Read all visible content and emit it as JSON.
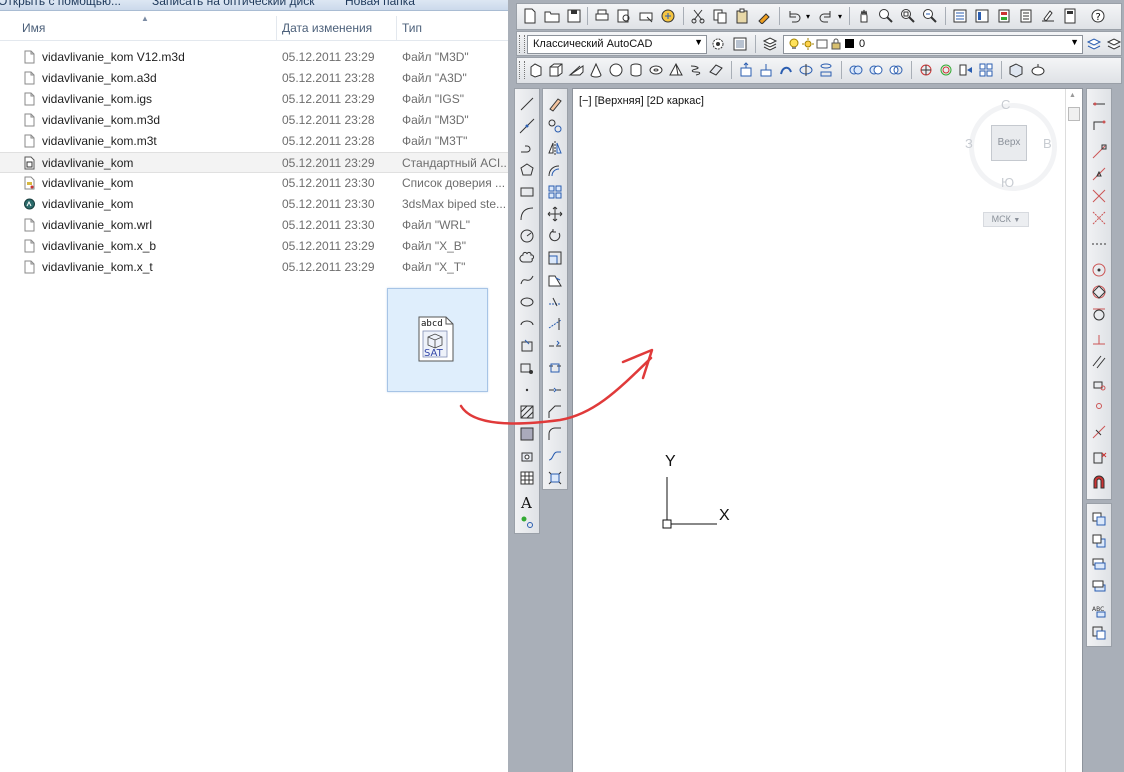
{
  "explorer": {
    "toolbar": {
      "open_with": "Открыть с помощью...",
      "burn": "Записать на оптический диск",
      "new_folder": "Новая папка"
    },
    "columns": {
      "name": "Имя",
      "date": "Дата изменения",
      "type": "Тип"
    },
    "files": [
      {
        "name": "vidavlivanie_kom V12.m3d",
        "date": "05.12.2011 23:29",
        "type": "Файл \"M3D\"",
        "icon": "document-icon"
      },
      {
        "name": "vidavlivanie_kom.a3d",
        "date": "05.12.2011 23:28",
        "type": "Файл \"A3D\"",
        "icon": "document-icon"
      },
      {
        "name": "vidavlivanie_kom.igs",
        "date": "05.12.2011 23:29",
        "type": "Файл \"IGS\"",
        "icon": "document-icon"
      },
      {
        "name": "vidavlivanie_kom.m3d",
        "date": "05.12.2011 23:28",
        "type": "Файл \"M3D\"",
        "icon": "document-icon"
      },
      {
        "name": "vidavlivanie_kom.m3t",
        "date": "05.12.2011 23:28",
        "type": "Файл \"M3T\"",
        "icon": "document-icon"
      },
      {
        "name": "vidavlivanie_kom",
        "date": "05.12.2011 23:29",
        "type": "Стандартный ACI...",
        "icon": "acis-file-icon",
        "selected": true
      },
      {
        "name": "vidavlivanie_kom",
        "date": "05.12.2011 23:30",
        "type": "Список доверия ...",
        "icon": "certificate-file-icon"
      },
      {
        "name": "vidavlivanie_kom",
        "date": "05.12.2011 23:30",
        "type": "3dsMax biped ste...",
        "icon": "3dsmax-file-icon"
      },
      {
        "name": "vidavlivanie_kom.wrl",
        "date": "05.12.2011 23:30",
        "type": "Файл \"WRL\"",
        "icon": "document-icon"
      },
      {
        "name": "vidavlivanie_kom.x_b",
        "date": "05.12.2011 23:29",
        "type": "Файл \"X_B\"",
        "icon": "document-icon"
      },
      {
        "name": "vidavlivanie_kom.x_t",
        "date": "05.12.2011 23:29",
        "type": "Файл \"X_T\"",
        "icon": "document-icon"
      }
    ],
    "drag_ghost": {
      "icon": "sat-file-icon",
      "icon_text_top": "abcd",
      "icon_text_bottom": "SAT"
    }
  },
  "autocad": {
    "workspace": "Классический AutoCAD",
    "layer": "0",
    "viewport_label": "[−] [Верхняя] [2D каркас]",
    "viewcube": {
      "north": "С",
      "south": "Ю",
      "west": "З",
      "east": "В",
      "face": "Верх",
      "ucs_menu": "МСК"
    },
    "ucs_icon": {
      "x_label": "X",
      "y_label": "Y"
    }
  },
  "colors": {
    "arrow": "#e03a3a",
    "toolbar_bg": "#e6e8eb",
    "app_frame": "#a9afb8",
    "ghost_bg": "#dfeefc"
  }
}
